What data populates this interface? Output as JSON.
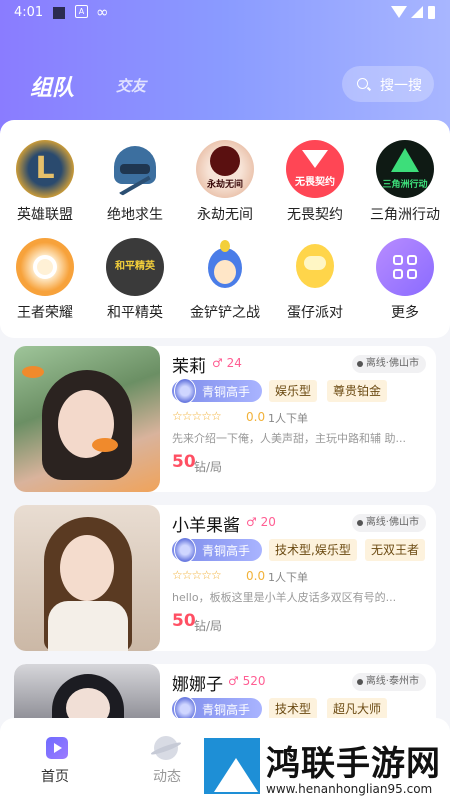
{
  "status_bar": {
    "time": "4:01",
    "app_icon_letter": "A",
    "extra": "∞"
  },
  "header": {
    "tab_active": "组队",
    "tab_inactive": "交友",
    "search_label": "搜一搜"
  },
  "games": [
    {
      "name": "英雄联盟",
      "glyph": "L",
      "color": "#1b3a5c"
    },
    {
      "name": "绝地求生",
      "glyph": "",
      "color": "#3c6f9f"
    },
    {
      "name": "永劫无间",
      "glyph": "永劫无间",
      "color": "#f0c9b5"
    },
    {
      "name": "无畏契约",
      "glyph": "无畏契约",
      "color": "#ff4655"
    },
    {
      "name": "三角洲行动",
      "glyph": "三角洲行动",
      "color": "#0f1a14"
    },
    {
      "name": "王者荣耀",
      "glyph": "",
      "color": "#f7a23b"
    },
    {
      "name": "和平精英",
      "glyph": "和平精英",
      "color": "#3a3a3a"
    },
    {
      "name": "金铲铲之战",
      "glyph": "",
      "color": "#4a7de8"
    },
    {
      "name": "蛋仔派对",
      "glyph": "",
      "color": "#ffd54a"
    },
    {
      "name": "更多",
      "glyph": "",
      "color": "#9c7bff"
    }
  ],
  "players": [
    {
      "nickname": "茉莉",
      "likes": "24",
      "location": "离线·佛山市",
      "rank": "青铜高手",
      "tags": [
        "娱乐型",
        "尊贵铂金"
      ],
      "rating": "0.0",
      "orders": "1人下单",
      "intro": "先来介绍一下俺，人美声甜，主玩中路和辅 助...",
      "price": "50",
      "unit": "钻/局"
    },
    {
      "nickname": "小羊果酱",
      "likes": "20",
      "location": "离线·佛山市",
      "rank": "青铜高手",
      "tags": [
        "技术型,娱乐型",
        "无双王者"
      ],
      "rating": "0.0",
      "orders": "1人下单",
      "intro": "hello，板板这里是小羊人皮话多双区有号的...",
      "price": "50",
      "unit": "钻/局"
    },
    {
      "nickname": "娜娜子",
      "likes": "520",
      "location": "离线·泰州市",
      "rank": "青铜高手",
      "tags": [
        "技术型",
        "超凡大师"
      ],
      "rating": "",
      "orders": "",
      "intro": "",
      "price": "",
      "unit": ""
    }
  ],
  "nav": {
    "home": "首页",
    "feed": "动态"
  },
  "watermark": {
    "title": "鸿联手游网",
    "url": "www.henanhonglian95.com"
  },
  "colors": {
    "accent": "#8a7cff",
    "price": "#ff4f63",
    "likes": "#ff5e93",
    "star": "#f2b23a"
  }
}
